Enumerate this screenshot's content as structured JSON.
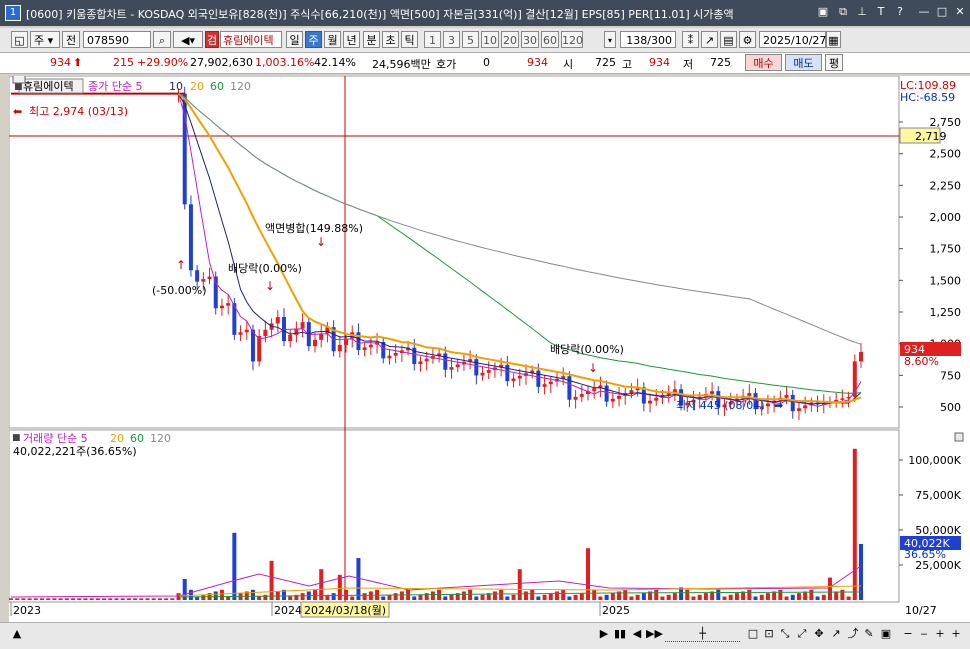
{
  "window": {
    "number": "1",
    "title": "[0600] 키움종합차트 - KOSDAQ 외국인보유[828(천)] 주식수[66,210(천)] 액면[500] 자본금[331(억)] 결산[12월] EPS[85] PER[11.01] 시가총액"
  },
  "toolbar": {
    "period_sel": "주",
    "tab_prev": "전",
    "code": "078590",
    "name_badge": "검",
    "stock_name": "휴림에이텍",
    "periods": [
      "일",
      "주",
      "월",
      "년",
      "분",
      "초",
      "틱"
    ],
    "active_period": "주",
    "intervals": [
      "1",
      "3",
      "5",
      "10",
      "20",
      "30",
      "60",
      "120"
    ],
    "count": "138",
    "count_total": "/300",
    "date": "2025/10/27"
  },
  "info": {
    "price": "934",
    "change": "215",
    "change_pct": "+29.90%",
    "volume": "27,902,630",
    "vol_ratio": "1,003.16%",
    "turnover": "42.14%",
    "amount": "24,596백만",
    "hoga_label": "호가",
    "hoga_val": "0",
    "hoga_price": "934",
    "open_label": "시",
    "open": "725",
    "high_label": "고",
    "high": "934",
    "low_label": "저",
    "low": "725",
    "buy": "매수",
    "sell": "매도",
    "eval": "평"
  },
  "chart_labels": {
    "legend_name": "휴림에이텍",
    "ma_legend": "종가 단순 5",
    "ma10": "10",
    "ma20": "20",
    "ma60": "60",
    "ma120": "120",
    "high_note": "최고 2,974 (03/13)",
    "low_note": "최저 445 (08/04)",
    "split_note": "액면병합(149.88%)",
    "div_note1": "배당락(0.00%)",
    "div_note2": "배당락(0.00%)",
    "adj_note": "(-50.00%)",
    "lc": "LC:109.89",
    "hc": "HC:-68.59",
    "hline_val": "2,719",
    "cur_price": "934",
    "cur_pct": "8.60%",
    "vol_legend": "거래량 단순 5",
    "vol_ma20": "20",
    "vol_ma60": "60",
    "vol_ma120": "120",
    "vol_value": "40,022,221주(36.65%)",
    "vol_cur": "40,022K",
    "vol_cur_pct": "36.65%",
    "date_cursor": "2024/03/18(월)",
    "date_right": "10/27"
  },
  "chart_data": {
    "type": "candlestick",
    "price_axis": [
      "2,750",
      "2,500",
      "2,250",
      "2,000",
      "1,750",
      "1,500",
      "1,250",
      "1,000",
      "750",
      "500"
    ],
    "price_ylim": [
      350,
      3050
    ],
    "volume_axis": [
      "100,000K",
      "75,000K",
      "50,000K",
      "25,000K"
    ],
    "volume_ylim": [
      0,
      120000
    ],
    "x_labels": [
      "2023",
      "2024",
      "2025"
    ],
    "series": [
      {
        "name": "5",
        "color": "#c020c0"
      },
      {
        "name": "10",
        "color": "#1a237e"
      },
      {
        "name": "20",
        "color": "#f0a000"
      },
      {
        "name": "60",
        "color": "#1a9a3a"
      },
      {
        "name": "120",
        "color": "#888888"
      }
    ],
    "colors": {
      "up": "#e02020",
      "down": "#2040d0"
    }
  }
}
